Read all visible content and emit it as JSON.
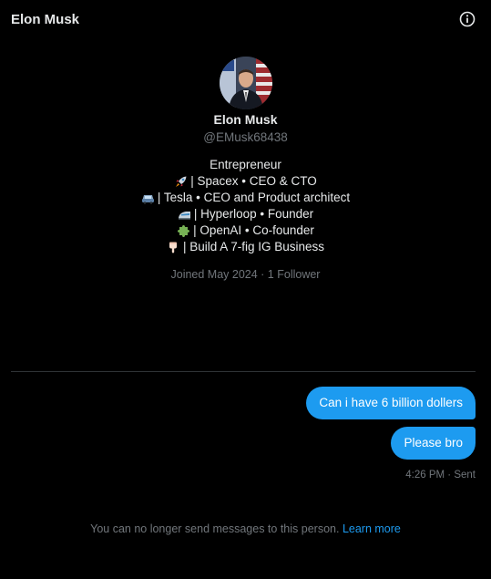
{
  "header": {
    "title": "Elon Musk",
    "info_icon": "info-circle-icon"
  },
  "profile": {
    "avatar_icon": "profile-avatar",
    "name": "Elon Musk",
    "handle": "@EMusk68438",
    "bio": [
      {
        "emoji": "",
        "text": "Entrepreneur"
      },
      {
        "emoji": "rocket-icon",
        "text": "| Spacex • CEO & CTO"
      },
      {
        "emoji": "car-icon",
        "text": "| Tesla • CEO and Product architect"
      },
      {
        "emoji": "train-icon",
        "text": "| Hyperloop • Founder"
      },
      {
        "emoji": "puzzle-icon",
        "text": "| OpenAI • Co-founder"
      },
      {
        "emoji": "pointing-down-icon",
        "text": "| Build A 7-fig IG Business"
      }
    ],
    "joined": "Joined May 2024 · 1 Follower"
  },
  "messages": [
    {
      "text": "Can i have 6 billion dollers"
    },
    {
      "text": "Please bro"
    }
  ],
  "message_status": "4:26 PM · Sent",
  "notice": {
    "text": "You can no longer send messages to this person. ",
    "link": "Learn more"
  },
  "colors": {
    "background": "#000000",
    "accent": "#1d9bf0",
    "text_primary": "#e7e9ea",
    "text_secondary": "#71767b",
    "divider": "#2f3336"
  }
}
